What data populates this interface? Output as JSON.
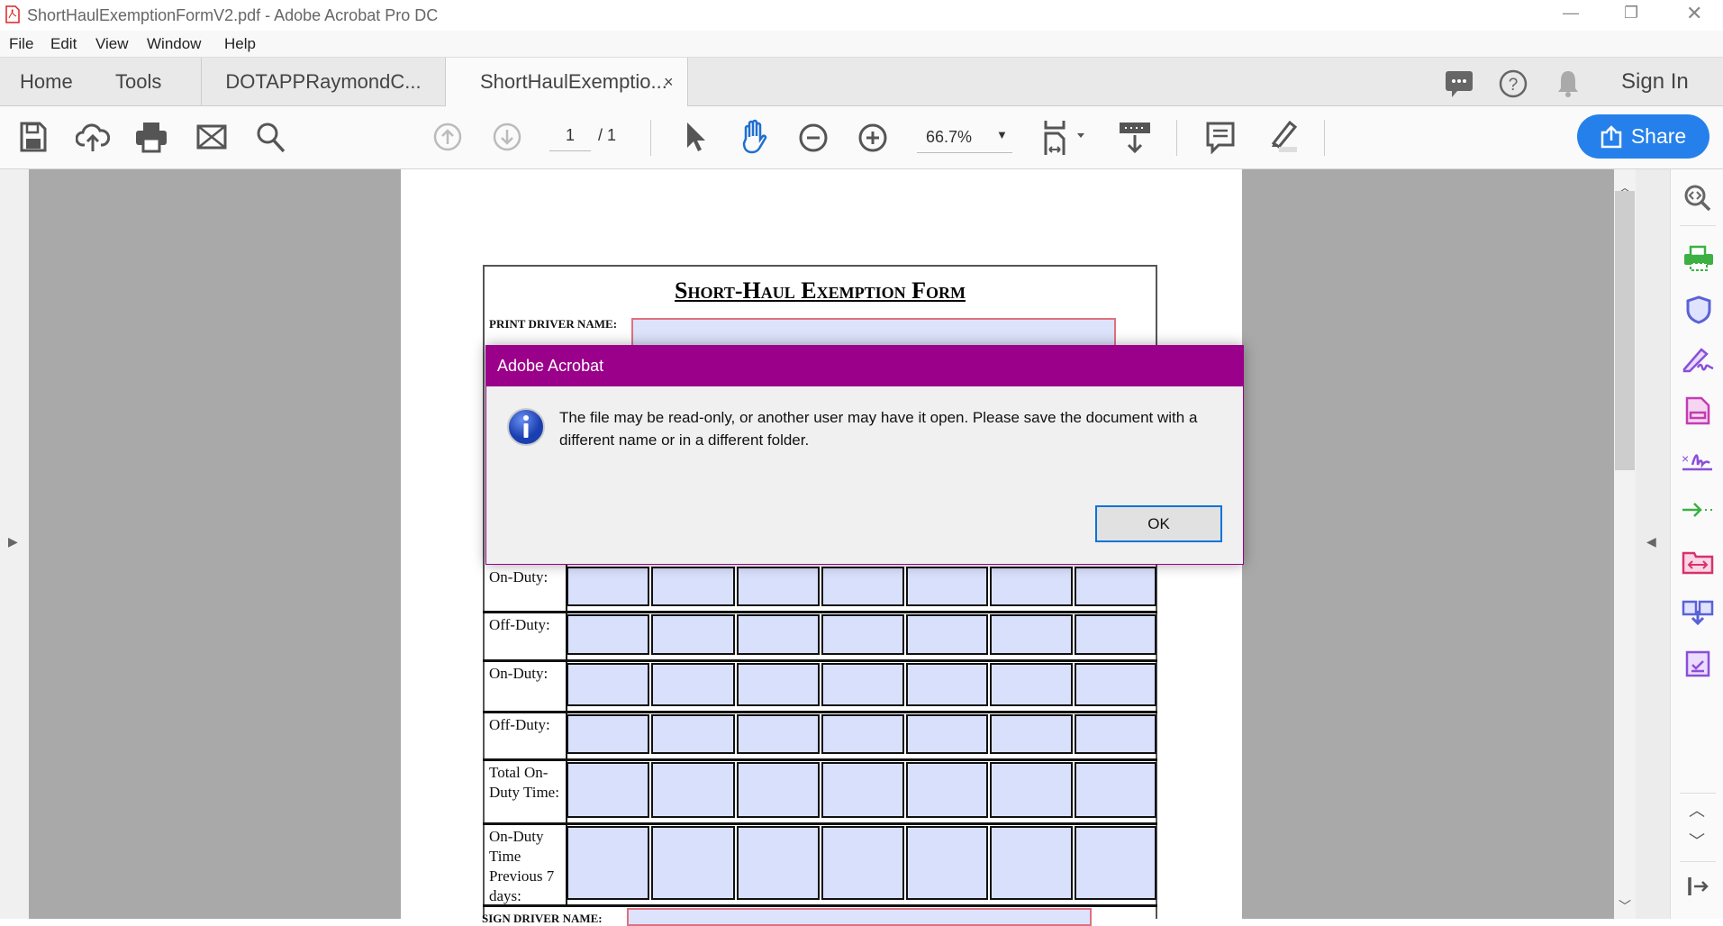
{
  "window": {
    "title": "ShortHaulExemptionFormV2.pdf - Adobe Acrobat Pro DC"
  },
  "menu": [
    "File",
    "Edit",
    "View",
    "Window",
    "Help"
  ],
  "tabs": {
    "home": "Home",
    "tools": "Tools",
    "doc1": "DOTAPPRaymondC...",
    "doc2": "ShortHaulExemptio...",
    "close": "×",
    "sign_in": "Sign In"
  },
  "toolbar": {
    "page_current": "1",
    "page_total": "/ 1",
    "zoom": "66.7%",
    "share": "Share"
  },
  "form": {
    "title": "Short-Haul Exemption Form",
    "print_driver_label": "PRINT DRIVER NAME:",
    "sign_driver_label": "SIGN DRIVER NAME:",
    "rows": [
      "On-Duty:",
      "Off-Duty:",
      "On-Duty:",
      "Off-Duty:",
      "Total On-Duty Time:",
      "On-Duty Time Previous 7 days:"
    ]
  },
  "dialog": {
    "title": "Adobe Acrobat",
    "message": "The file may be read-only, or another user may have it open. Please save the document with a different name or in a different folder.",
    "ok": "OK"
  },
  "colors": {
    "dialog_title": "#9b008b",
    "share": "#2680eb",
    "field": "#dde3fb"
  }
}
